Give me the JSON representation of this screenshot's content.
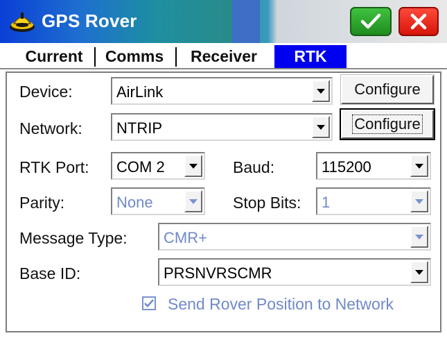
{
  "window": {
    "title": "GPS Rover",
    "ok_icon": "checkmark-icon",
    "close_icon": "close-icon",
    "colors": {
      "ok": "#1f8c1f",
      "close": "#d7140b",
      "active_tab": "#0000f0"
    }
  },
  "tabs": [
    {
      "label": "Current",
      "active": false
    },
    {
      "label": "Comms",
      "active": false
    },
    {
      "label": "Receiver",
      "active": false
    },
    {
      "label": "RTK",
      "active": true
    }
  ],
  "form": {
    "device": {
      "label": "Device:",
      "value": "AirLink",
      "button": "Configure"
    },
    "network": {
      "label": "Network:",
      "value": "NTRIP",
      "button": "Configure"
    },
    "rtk_port": {
      "label": "RTK Port:",
      "value": "COM 2"
    },
    "baud": {
      "label": "Baud:",
      "value": "115200"
    },
    "parity": {
      "label": "Parity:",
      "value": "None",
      "disabled": true
    },
    "stop_bits": {
      "label": "Stop Bits:",
      "value": "1",
      "disabled": true
    },
    "message_type": {
      "label": "Message Type:",
      "value": "CMR+",
      "disabled": true
    },
    "base_id": {
      "label": "Base ID:",
      "value": "PRSNVRSCMR"
    },
    "send_position": {
      "label": "Send Rover Position to Network",
      "checked": true,
      "disabled": true
    }
  }
}
